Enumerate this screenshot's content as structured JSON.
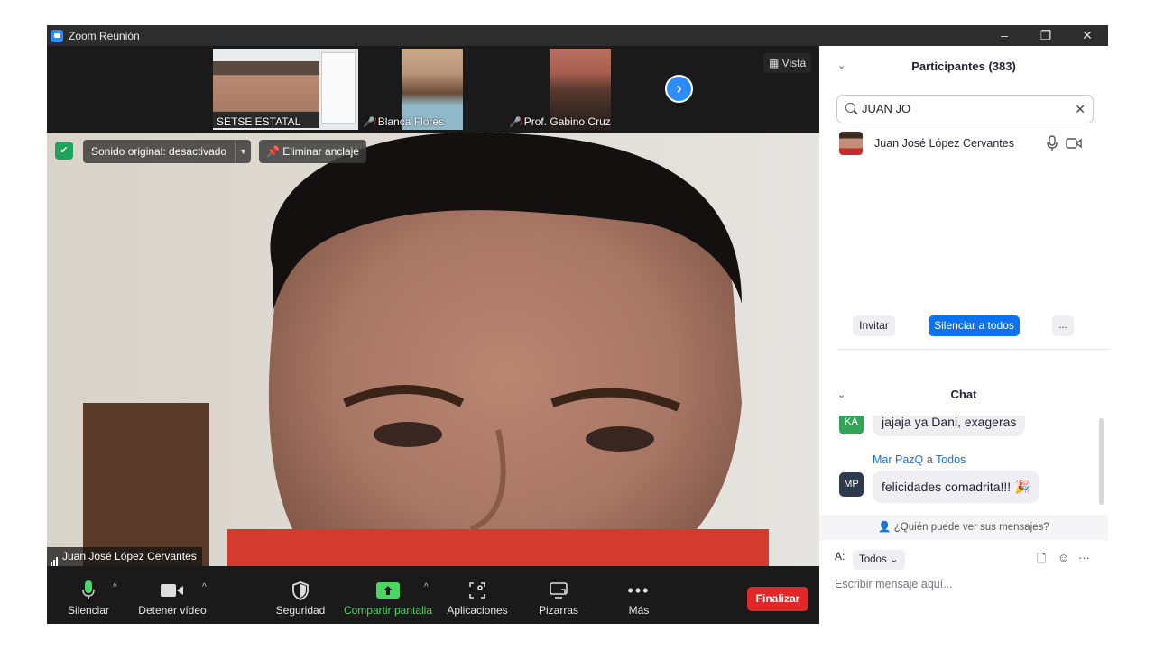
{
  "window": {
    "title": "Zoom Reunión",
    "controls": [
      "–",
      "❐",
      "✕"
    ]
  },
  "video_strip": {
    "thumbnails": [
      {
        "name": "SETSE ESTATAL",
        "muted": false
      },
      {
        "name": "Blanca Flores",
        "muted": true
      },
      {
        "name": "Prof. Gabino Cruz",
        "muted": true
      }
    ],
    "next_glyph": "›",
    "view_label": "Vista"
  },
  "main_video": {
    "sound_label": "Sonido original: desactivado",
    "unpin_label": "Eliminar anclaje",
    "speaker": "Juan José López Cervantes"
  },
  "toolbar": {
    "mute": "Silenciar",
    "stop_video": "Detener vídeo",
    "security": "Seguridad",
    "share": "Compartir pantalla",
    "apps": "Aplicaciones",
    "whiteboards": "Pizarras",
    "more": "Más",
    "end": "Finalizar",
    "share_color": "#4ad662"
  },
  "participants": {
    "title": "Participantes (383)",
    "search_value": "JUAN JO",
    "list": [
      {
        "name": "Juan José López Cervantes"
      }
    ],
    "invite": "Invitar",
    "mute_all": "Silenciar a todos",
    "more": "..."
  },
  "chat": {
    "title": "Chat",
    "messages": [
      {
        "initials": "KA",
        "text": "jajaja ya Dani, exageras",
        "avatar_color": "#33a356"
      },
      {
        "initials": "MP",
        "sender": "Mar PazQ",
        "to_word": "a",
        "recipient": "Todos",
        "text": "felicidades comadrita!!! 🎉",
        "avatar_color": "#2e3a4d"
      }
    ],
    "who_can_see": "¿Quién puede ver sus mensajes?",
    "to_label": "A:",
    "to_value": "Todos",
    "placeholder": "Escribir mensaje aquí..."
  },
  "colors": {
    "accent": "#0e72ed",
    "end": "#e02828",
    "security_green": "#1fa35a",
    "muted_red": "#e03434"
  }
}
